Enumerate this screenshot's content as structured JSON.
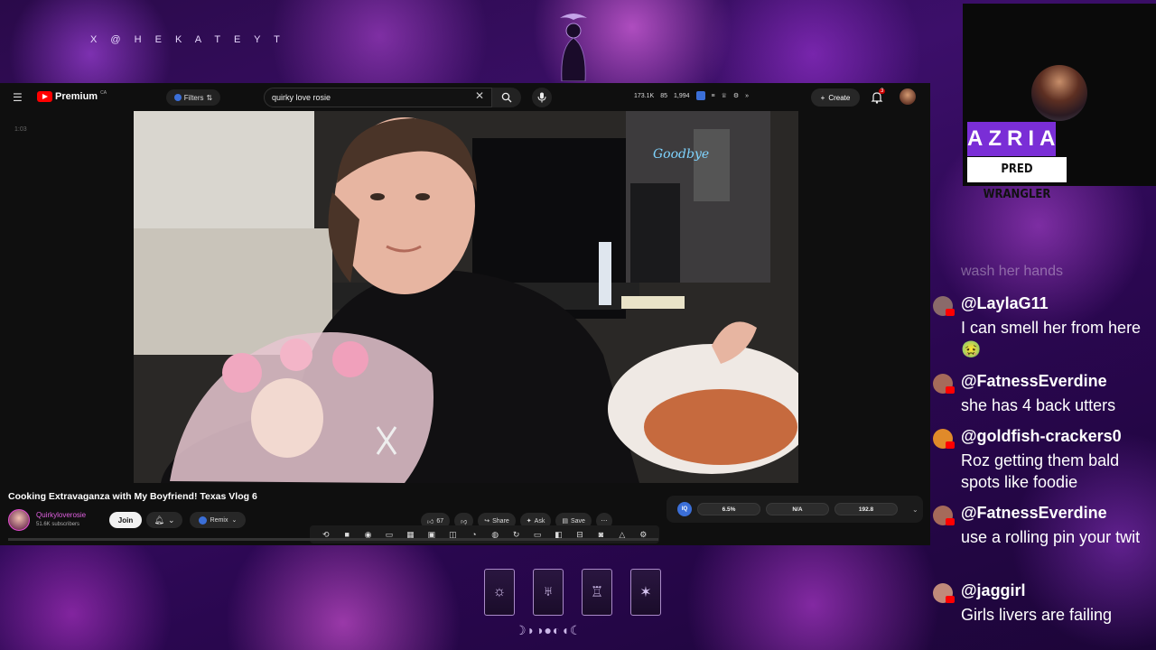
{
  "overlay": {
    "handle": "X @ H E K A T E Y T"
  },
  "youtube": {
    "logo_text": "Premium",
    "logo_sup": "CA",
    "filters_label": "Filters",
    "search_value": "quirky love rosie",
    "stats": [
      "173.1K",
      "85",
      "1,994"
    ],
    "create_label": "Create",
    "notifications": "3",
    "timecode": "1:03",
    "video_title": "Cooking Extravaganza with My Boyfriend! Texas Vlog 6",
    "channel_name": "Quirkyloverosie",
    "channel_subs": "51.6K subscribers",
    "join_label": "Join",
    "remix_label": "Remix",
    "likes": "67",
    "share_label": "Share",
    "ask_label": "Ask",
    "save_label": "Save",
    "ext_logo": "IQ",
    "ext_values": [
      "6.5%",
      "N/A",
      "192.8"
    ]
  },
  "streamer": {
    "name": "AZRIA",
    "role": "PRED WRANGLER"
  },
  "chat": {
    "faded": "wash her hands",
    "messages": [
      {
        "user": "@LaylaG11",
        "text": "I can smell her from here 🤢",
        "avatar_color": "#8a6a6a"
      },
      {
        "user": "@FatnessEverdine",
        "text": "she has 4 back utters",
        "avatar_color": "#a56a5a"
      },
      {
        "user": "@goldfish-crackers0",
        "text": "Roz getting them bald spots like foodie",
        "avatar_color": "#e08a2a"
      },
      {
        "user": "@FatnessEverdine",
        "text": "use a rolling pin your twit",
        "avatar_color": "#a56a5a"
      },
      {
        "user": "@jaggirl",
        "text": "Girls livers are failing",
        "avatar_color": "#c08a7a"
      }
    ]
  }
}
